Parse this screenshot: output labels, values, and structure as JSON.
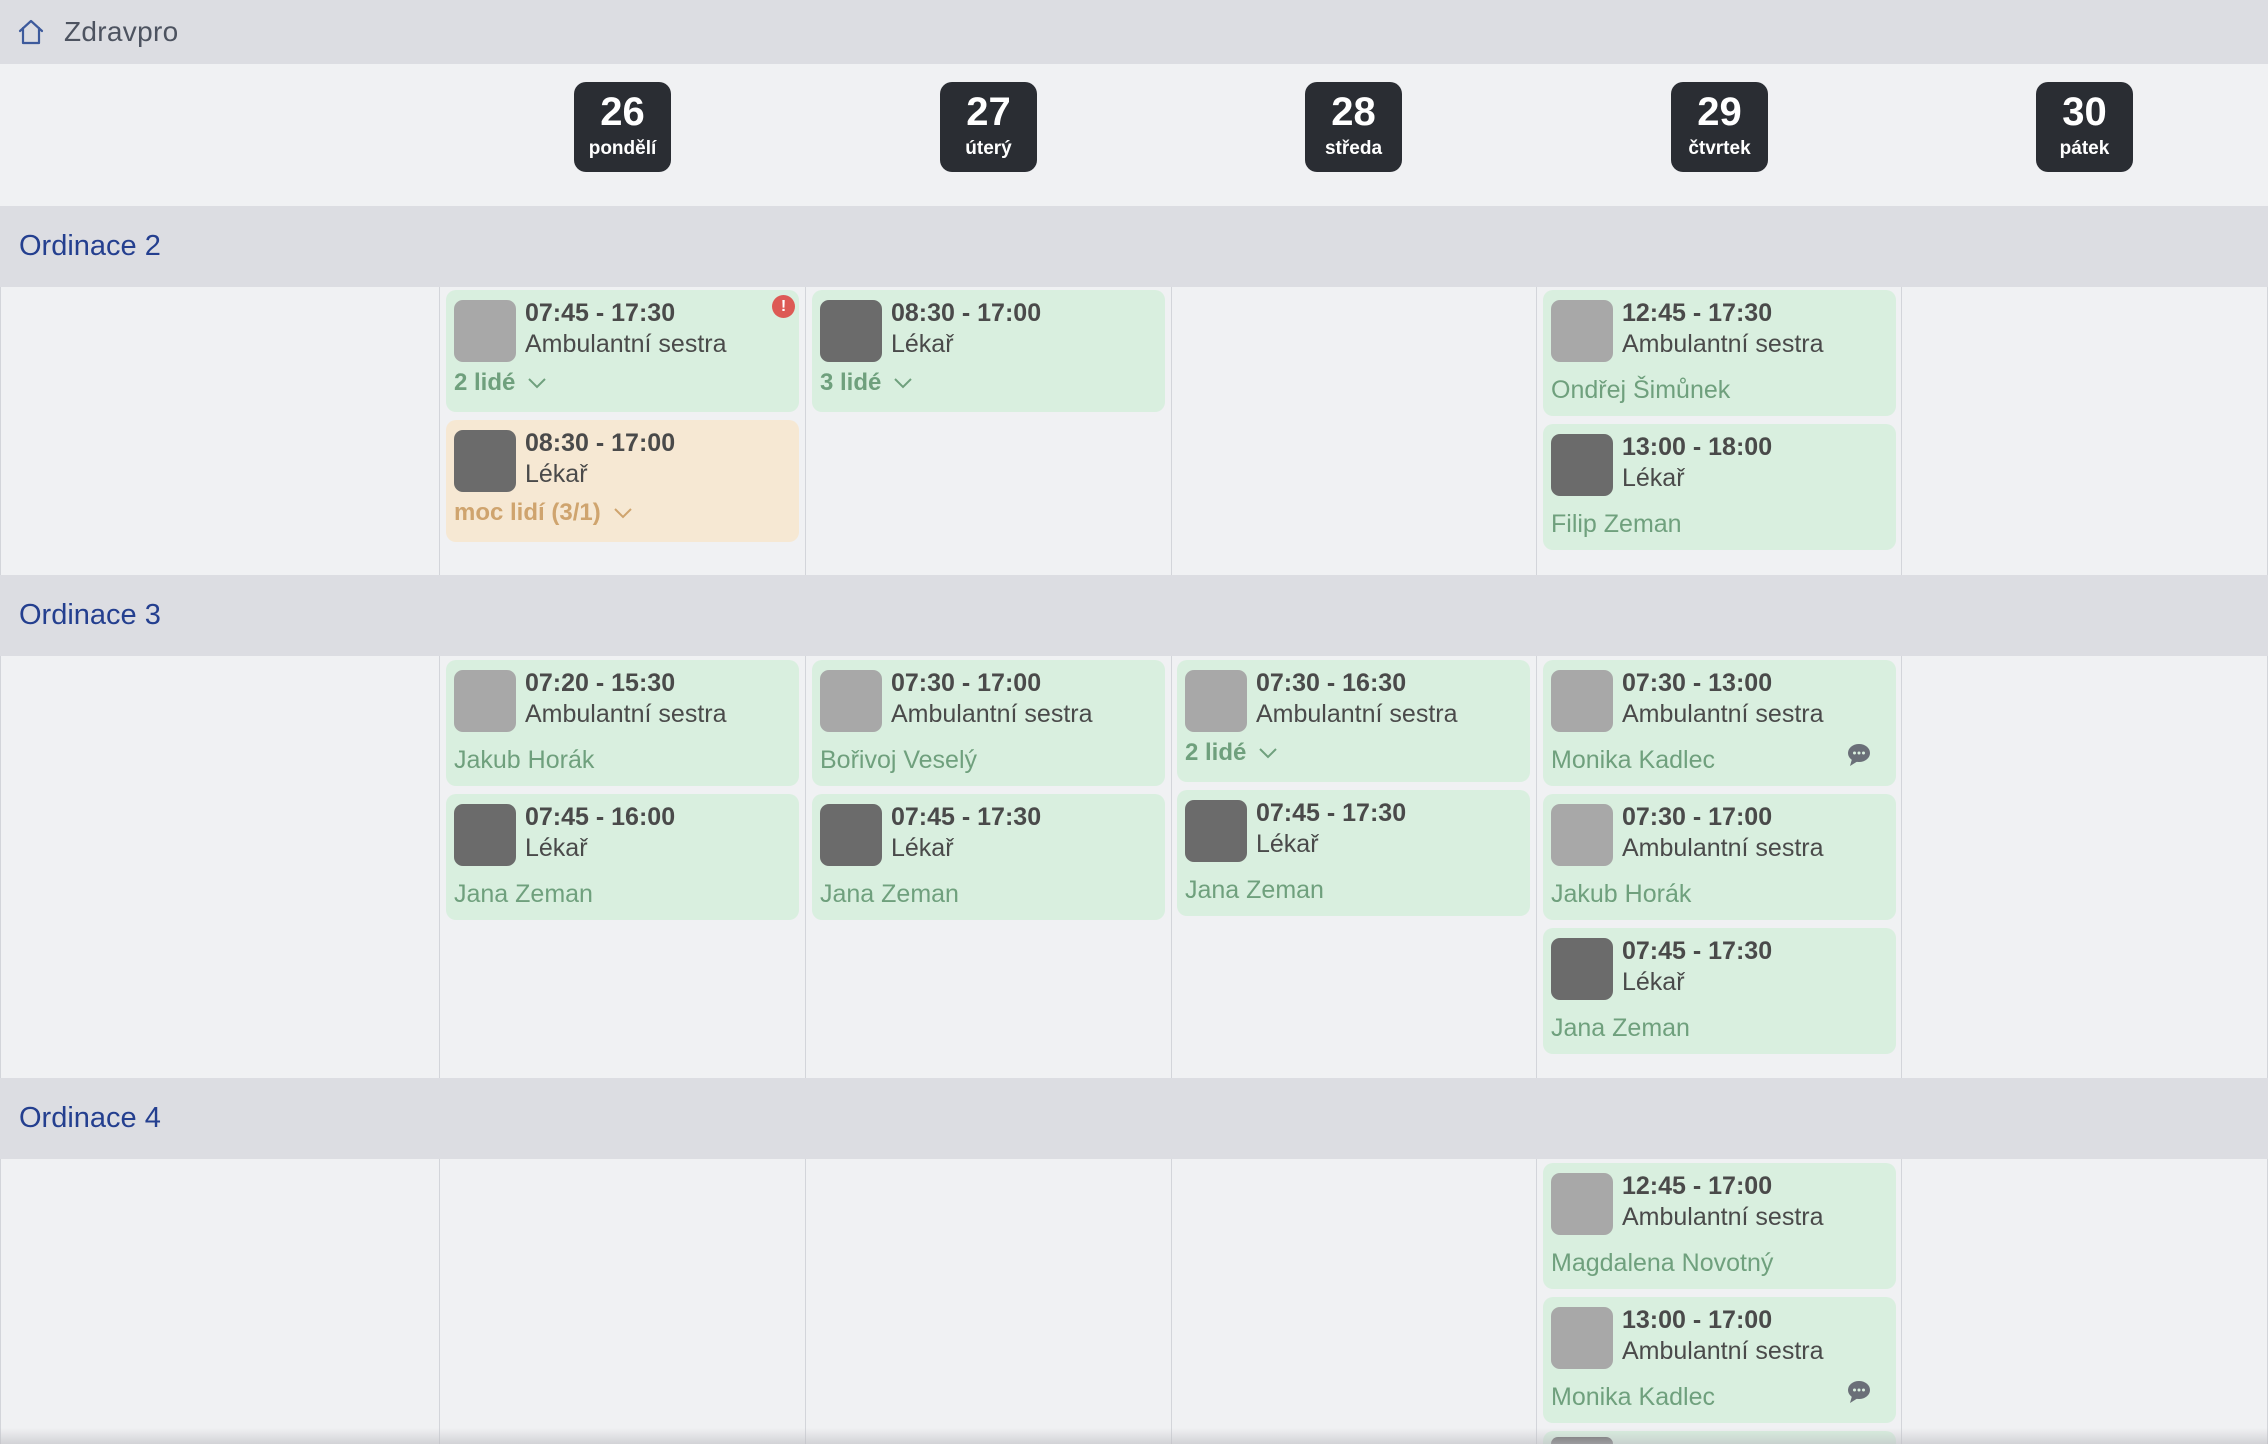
{
  "app": {
    "title": "Zdravpro",
    "home_icon": "home-icon"
  },
  "days": [
    {
      "num": "26",
      "name": "pondělí"
    },
    {
      "num": "27",
      "name": "úterý"
    },
    {
      "num": "28",
      "name": "středa"
    },
    {
      "num": "29",
      "name": "čtvrtek"
    },
    {
      "num": "30",
      "name": "pátek"
    }
  ],
  "sections": [
    {
      "name": "Ordinace 2"
    },
    {
      "name": "Ordinace 3"
    },
    {
      "name": "Ordinace 4"
    }
  ],
  "shifts": {
    "o2_d26_a": {
      "time": "07:45 - 17:30",
      "role": "Ambulantní sestra",
      "more": "2 lidé",
      "alert": "!"
    },
    "o2_d26_b": {
      "time": "08:30 - 17:00",
      "role": "Lékař",
      "more": "moc lidí (3/1)"
    },
    "o2_d27_a": {
      "time": "08:30 - 17:00",
      "role": "Lékař",
      "more": "3 lidé"
    },
    "o2_d29_a": {
      "time": "12:45 - 17:30",
      "role": "Ambulantní sestra",
      "who": "Ondřej Šimůnek"
    },
    "o2_d29_b": {
      "time": "13:00 - 18:00",
      "role": "Lékař",
      "who": "Filip Zeman"
    },
    "o3_d26_a": {
      "time": "07:20 - 15:30",
      "role": "Ambulantní sestra",
      "who": "Jakub Horák"
    },
    "o3_d26_b": {
      "time": "07:45 - 16:00",
      "role": "Lékař",
      "who": "Jana Zeman"
    },
    "o3_d27_a": {
      "time": "07:30 - 17:00",
      "role": "Ambulantní sestra",
      "who": "Bořivoj Veselý"
    },
    "o3_d27_b": {
      "time": "07:45 - 17:30",
      "role": "Lékař",
      "who": "Jana Zeman"
    },
    "o3_d28_a": {
      "time": "07:30 - 16:30",
      "role": "Ambulantní sestra",
      "more": "2 lidé"
    },
    "o3_d28_b": {
      "time": "07:45 - 17:30",
      "role": "Lékař",
      "who": "Jana Zeman"
    },
    "o3_d29_a": {
      "time": "07:30 - 13:00",
      "role": "Ambulantní sestra",
      "who": "Monika Kadlec"
    },
    "o3_d29_b": {
      "time": "07:30 - 17:00",
      "role": "Ambulantní sestra",
      "who": "Jakub Horák"
    },
    "o3_d29_c": {
      "time": "07:45 - 17:30",
      "role": "Lékař",
      "who": "Jana Zeman"
    },
    "o4_d29_a": {
      "time": "12:45 - 17:00",
      "role": "Ambulantní sestra",
      "who": "Magdalena Novotný"
    },
    "o4_d29_b": {
      "time": "13:00 - 17:00",
      "role": "Ambulantní sestra",
      "who": "Monika Kadlec"
    }
  },
  "colors": {
    "shift_ok": "#d9efdf",
    "shift_warn": "#f6e8d3",
    "badge": "#2a2d33",
    "section_text": "#243f8f",
    "alert": "#dd5a55"
  }
}
